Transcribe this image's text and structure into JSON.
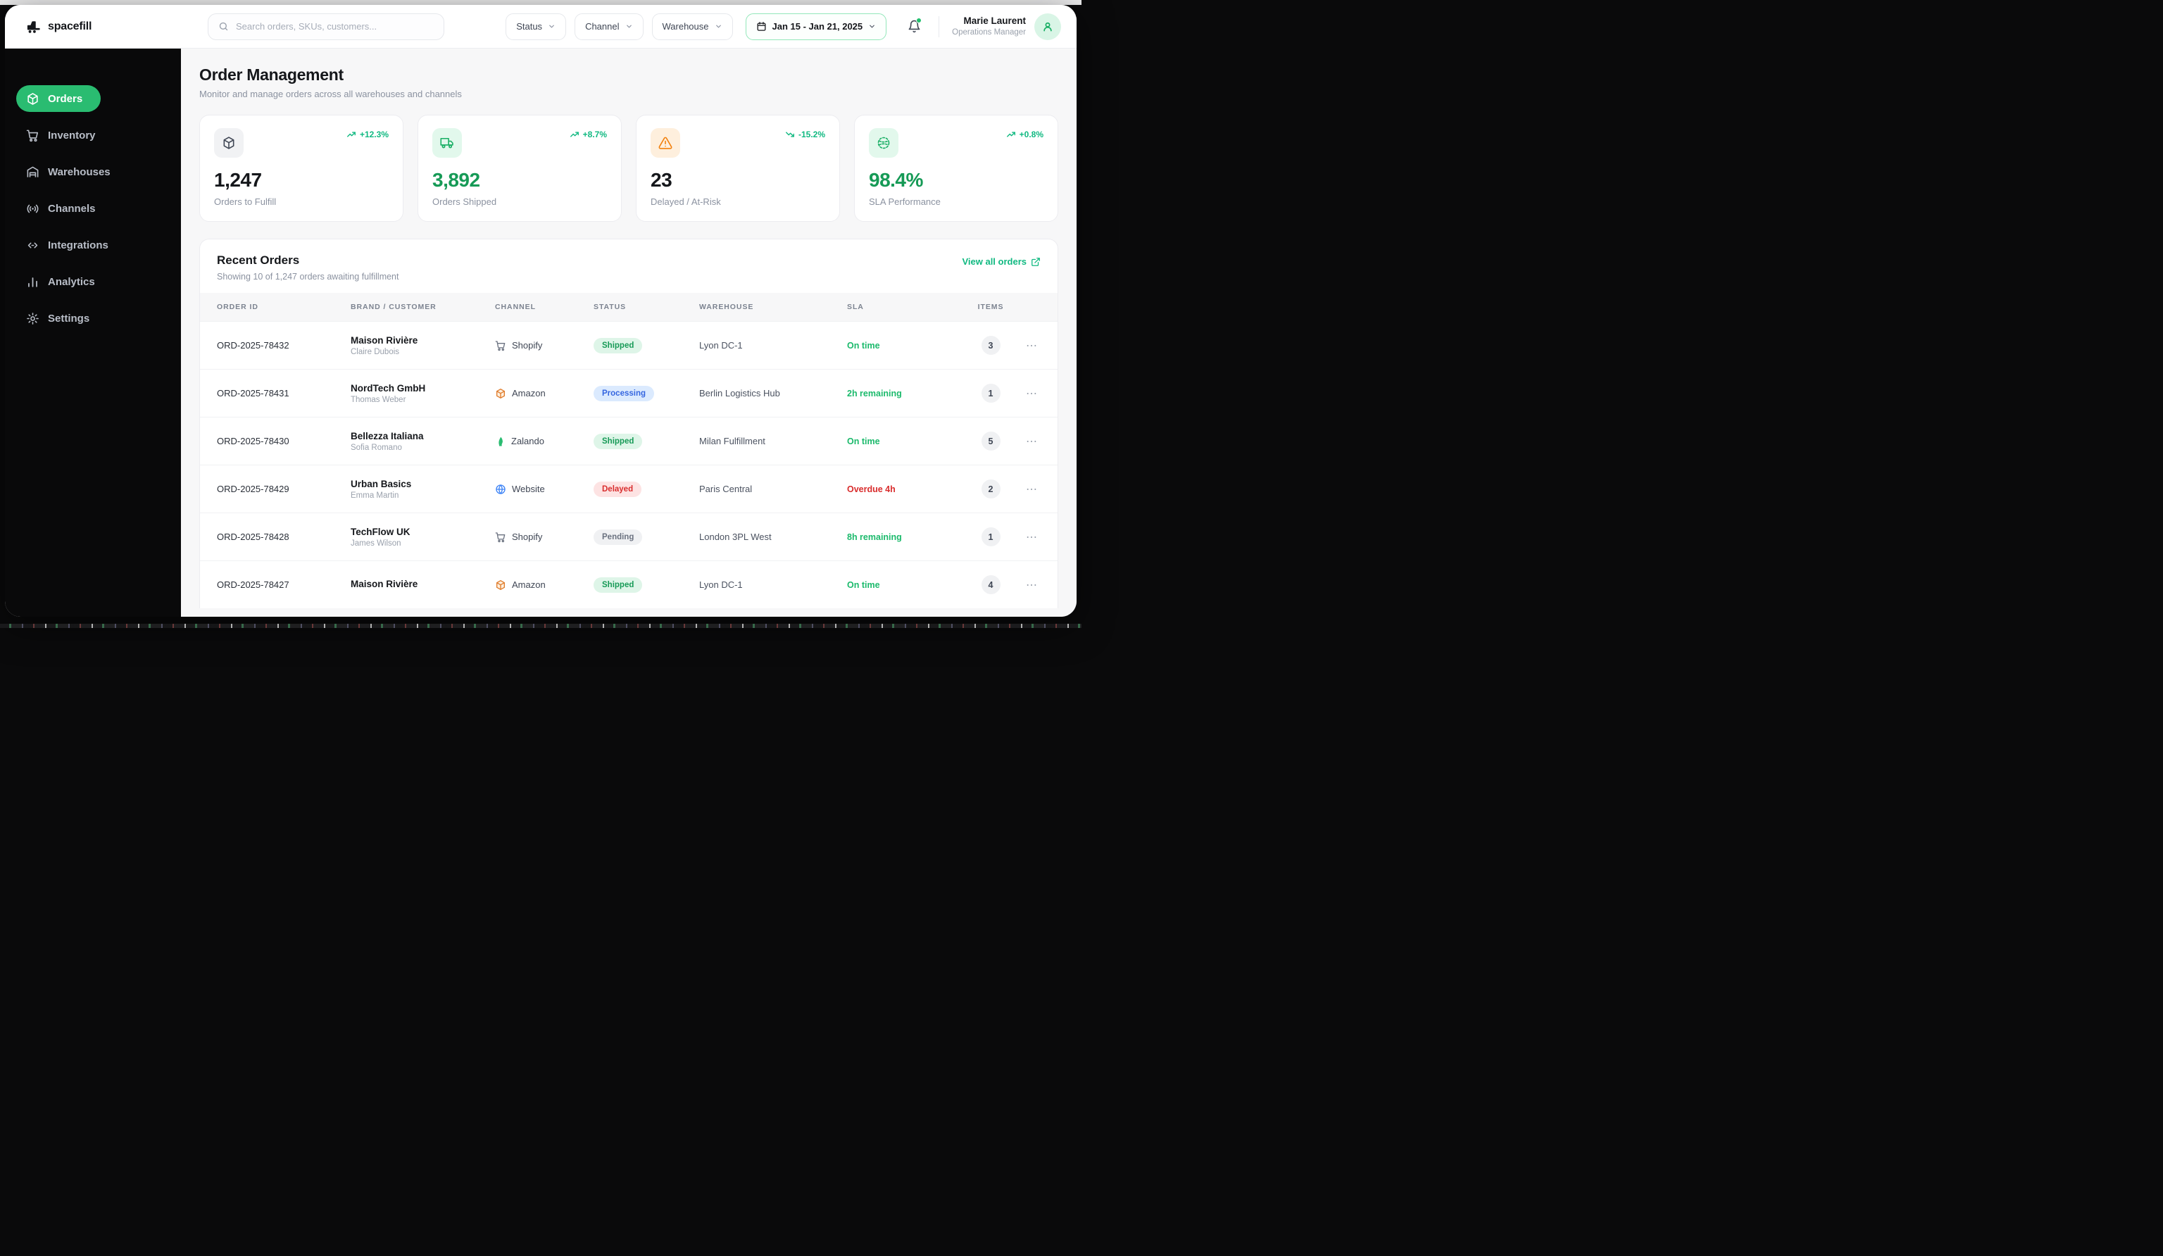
{
  "brand": {
    "name": "spacefill"
  },
  "topbar": {
    "search_placeholder": "Search orders, SKUs, customers...",
    "filters": [
      {
        "label": "Status"
      },
      {
        "label": "Channel"
      },
      {
        "label": "Warehouse"
      }
    ],
    "date_range": "Jan 15 - Jan 21, 2025",
    "user": {
      "name": "Marie Laurent",
      "role": "Operations Manager"
    }
  },
  "sidebar": {
    "items": [
      {
        "label": "Orders"
      },
      {
        "label": "Inventory"
      },
      {
        "label": "Warehouses"
      },
      {
        "label": "Channels"
      },
      {
        "label": "Integrations"
      },
      {
        "label": "Analytics"
      },
      {
        "label": "Settings"
      }
    ]
  },
  "page": {
    "title": "Order Management",
    "subtitle": "Monitor and manage orders across all warehouses and channels"
  },
  "stats": [
    {
      "value": "1,247",
      "label": "Orders to Fulfill",
      "trend": "+12.3%",
      "trend_dir": "up",
      "icon": "package-icon"
    },
    {
      "value": "3,892",
      "label": "Orders Shipped",
      "trend": "+8.7%",
      "trend_dir": "up",
      "icon": "truck-icon"
    },
    {
      "value": "23",
      "label": "Delayed / At-Risk",
      "trend": "-15.2%",
      "trend_dir": "down",
      "icon": "alert-triangle-icon"
    },
    {
      "value": "98.4%",
      "label": "SLA Performance",
      "trend": "+0.8%",
      "trend_dir": "up",
      "icon": "sphere-icon"
    }
  ],
  "orders": {
    "title": "Recent Orders",
    "subtitle": "Showing 10 of 1,247 orders awaiting fulfillment",
    "view_all_label": "View all orders",
    "columns": [
      "Order ID",
      "Brand / Customer",
      "Channel",
      "Status",
      "Warehouse",
      "SLA",
      "Items"
    ],
    "rows": [
      {
        "id": "ORD-2025-78432",
        "brand": "Maison Rivière",
        "customer": "Claire Dubois",
        "channel": "Shopify",
        "status": "Shipped",
        "warehouse": "Lyon DC-1",
        "sla": "On time",
        "items": "3"
      },
      {
        "id": "ORD-2025-78431",
        "brand": "NordTech GmbH",
        "customer": "Thomas Weber",
        "channel": "Amazon",
        "status": "Processing",
        "warehouse": "Berlin Logistics Hub",
        "sla": "2h remaining",
        "items": "1"
      },
      {
        "id": "ORD-2025-78430",
        "brand": "Bellezza Italiana",
        "customer": "Sofia Romano",
        "channel": "Zalando",
        "status": "Shipped",
        "warehouse": "Milan Fulfillment",
        "sla": "On time",
        "items": "5"
      },
      {
        "id": "ORD-2025-78429",
        "brand": "Urban Basics",
        "customer": "Emma Martin",
        "channel": "Website",
        "status": "Delayed",
        "warehouse": "Paris Central",
        "sla": "Overdue 4h",
        "items": "2"
      },
      {
        "id": "ORD-2025-78428",
        "brand": "TechFlow UK",
        "customer": "James Wilson",
        "channel": "Shopify",
        "status": "Pending",
        "warehouse": "London 3PL West",
        "sla": "8h remaining",
        "items": "1"
      },
      {
        "id": "ORD-2025-78427",
        "brand": "Maison Rivière",
        "customer": "",
        "channel": "Amazon",
        "status": "Shipped",
        "warehouse": "Lyon DC-1",
        "sla": "On time",
        "items": "4"
      }
    ]
  },
  "colors": {
    "accent_green": "#2abc71",
    "text_green": "#169a56",
    "status_red": "#d92d2d",
    "status_blue": "#3566e0",
    "warning_orange": "#f2800d",
    "sidebar_bg": "#09090a"
  }
}
